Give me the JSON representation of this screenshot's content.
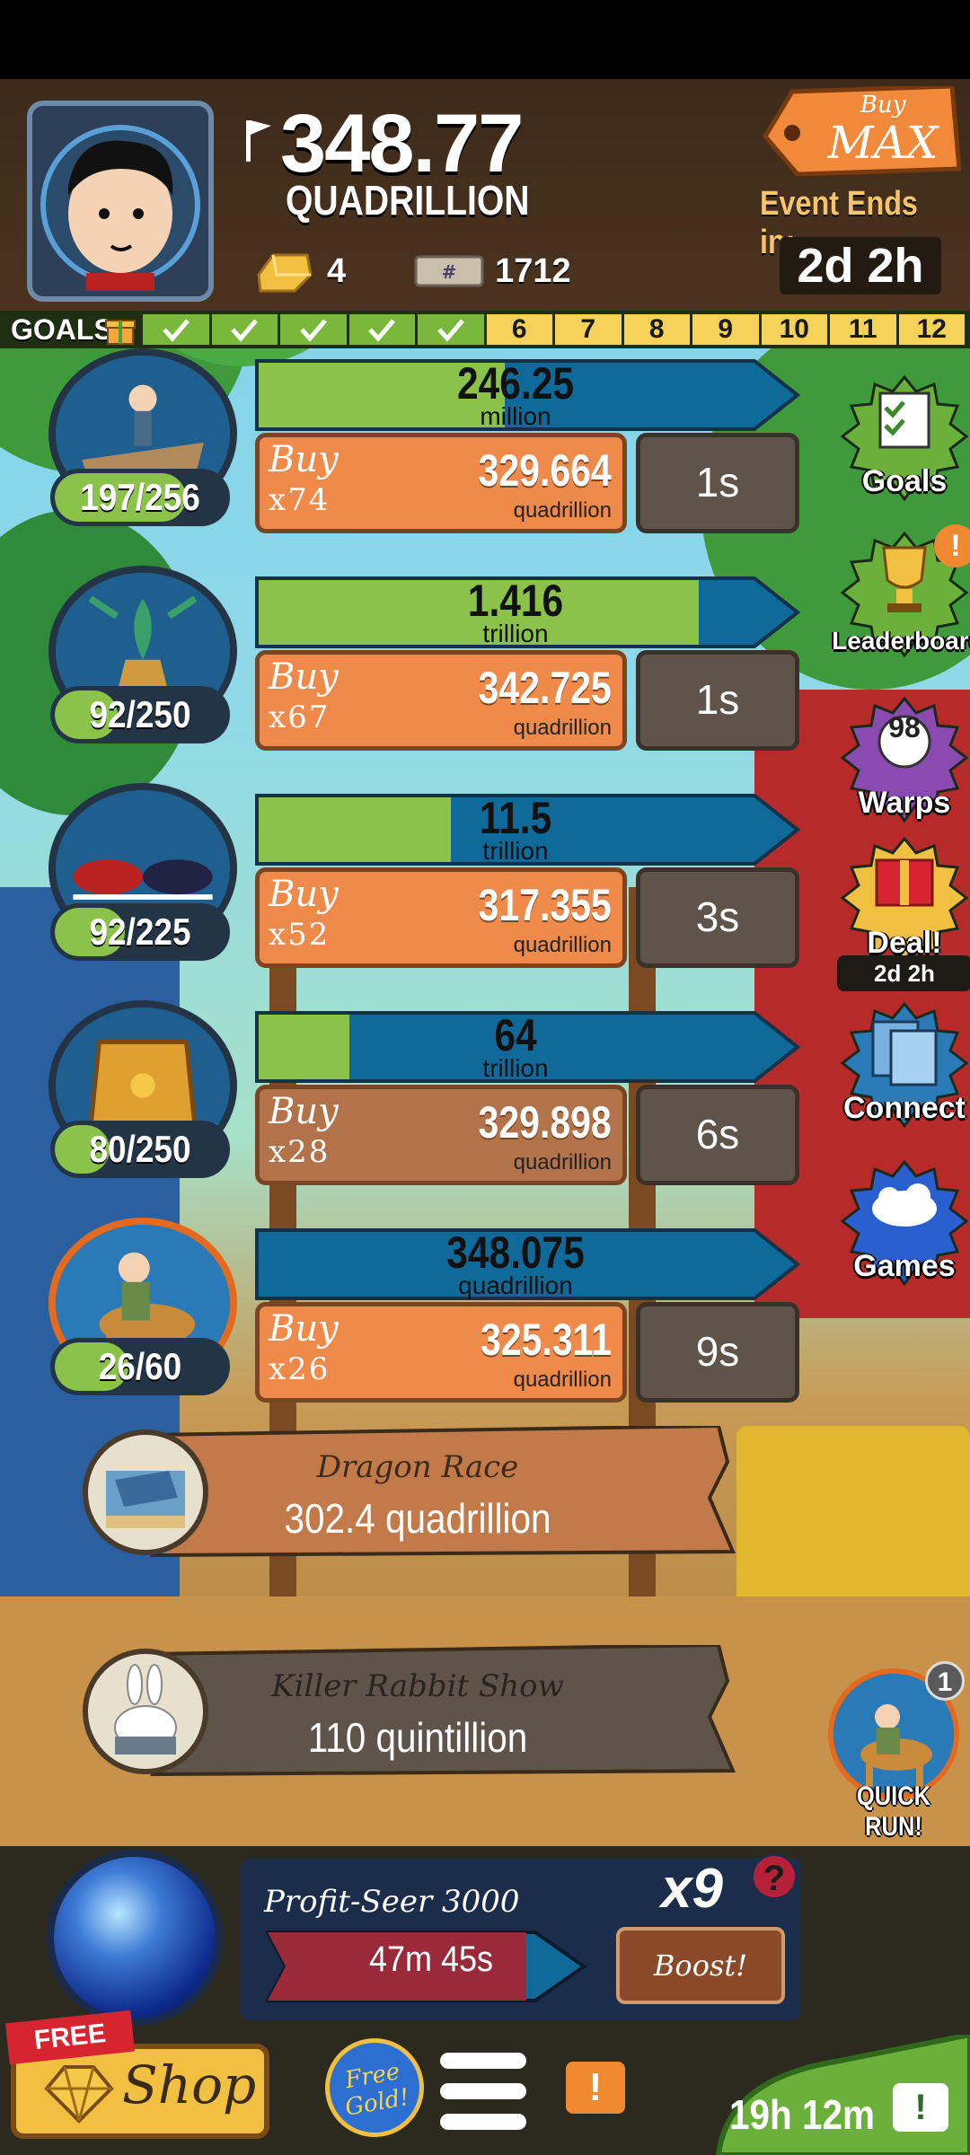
{
  "hud": {
    "money_value": "348.77",
    "money_unit": "QUADRILLION",
    "gold_bars": "4",
    "megabucks": "1712",
    "buy_mode_top": "Buy",
    "buy_mode_bottom": "MAX",
    "event_label": "Event Ends in:",
    "event_time": "2d 2h"
  },
  "goals": {
    "label": "GOALS",
    "completed": 5,
    "cells": [
      "",
      "",
      "",
      "",
      "",
      "6",
      "7",
      "8",
      "9",
      "10",
      "11",
      "12"
    ]
  },
  "businesses": [
    {
      "count": "197/256",
      "count_fraction": 0.77,
      "progress_value": "246.25",
      "progress_unit": "million",
      "progress_fraction": 0.44,
      "buy_word": "Buy",
      "buy_qty": "x74",
      "cost": "329.664",
      "cost_unit": "quadrillion",
      "timer": "1s",
      "icon": "raft-icon"
    },
    {
      "count": "92/250",
      "count_fraction": 0.37,
      "progress_value": "1.416",
      "progress_unit": "trillion",
      "progress_fraction": 0.84,
      "buy_word": "Buy",
      "buy_qty": "x67",
      "cost": "342.725",
      "cost_unit": "quadrillion",
      "timer": "1s",
      "icon": "dragon-statue-icon"
    },
    {
      "count": "92/225",
      "count_fraction": 0.41,
      "progress_value": "11.5",
      "progress_unit": "trillion",
      "progress_fraction": 0.33,
      "buy_word": "Buy",
      "buy_qty": "x52",
      "cost": "317.355",
      "cost_unit": "quadrillion",
      "timer": "3s",
      "icon": "jousting-horses-icon"
    },
    {
      "count": "80/250",
      "count_fraction": 0.32,
      "progress_value": "64",
      "progress_unit": "trillion",
      "progress_fraction": 0.12,
      "buy_word": "Buy",
      "buy_qty": "x28",
      "cost": "329.898",
      "cost_unit": "quadrillion",
      "timer": "6s",
      "icon": "armor-icon"
    },
    {
      "count": "26/60",
      "count_fraction": 0.43,
      "progress_value": "348.075",
      "progress_unit": "quadrillion",
      "progress_fraction": 0.0,
      "buy_word": "Buy",
      "buy_qty": "x26",
      "cost": "325.311",
      "cost_unit": "quadrillion",
      "timer": "9s",
      "icon": "horse-rider-icon"
    }
  ],
  "side_buttons": [
    {
      "label": "Goals",
      "icon": "checklist-icon"
    },
    {
      "label": "Leaderboard",
      "icon": "trophy-icon",
      "badge": "!"
    },
    {
      "label": "Warps",
      "icon": "warp-ball-icon",
      "badge": "98"
    },
    {
      "label": "Deal!",
      "icon": "gift-icon",
      "sub": "2d 2h"
    },
    {
      "label": "Connect",
      "icon": "cards-icon"
    },
    {
      "label": "Games",
      "icon": "cloud-icon"
    }
  ],
  "locked": [
    {
      "name": "Dragon Race",
      "cost": "302.4 quadrillion",
      "icon": "dragon-race-icon"
    },
    {
      "name": "Killer Rabbit Show",
      "cost": "110 quintillion",
      "icon": "rabbit-icon"
    }
  ],
  "quick_run": {
    "label": "QUICK RUN!",
    "badge": "1"
  },
  "bottom": {
    "seer_name": "Profit-Seer 3000",
    "seer_multiplier": "x9",
    "seer_help": "?",
    "seer_time": "47m 45s",
    "boost_label": "Boost!",
    "free_tag": "FREE",
    "shop_label": "Shop",
    "free_gold_label": "Free Gold!",
    "alert": "!",
    "timer": "19h 12m",
    "timer_icon": "!"
  },
  "colors": {
    "progress_green": "#8bc34a",
    "progress_blue": "#0f6a99",
    "buy_orange": "#ef8a4a",
    "hud_brown": "#3e2a1a",
    "gold": "#f2c040"
  }
}
